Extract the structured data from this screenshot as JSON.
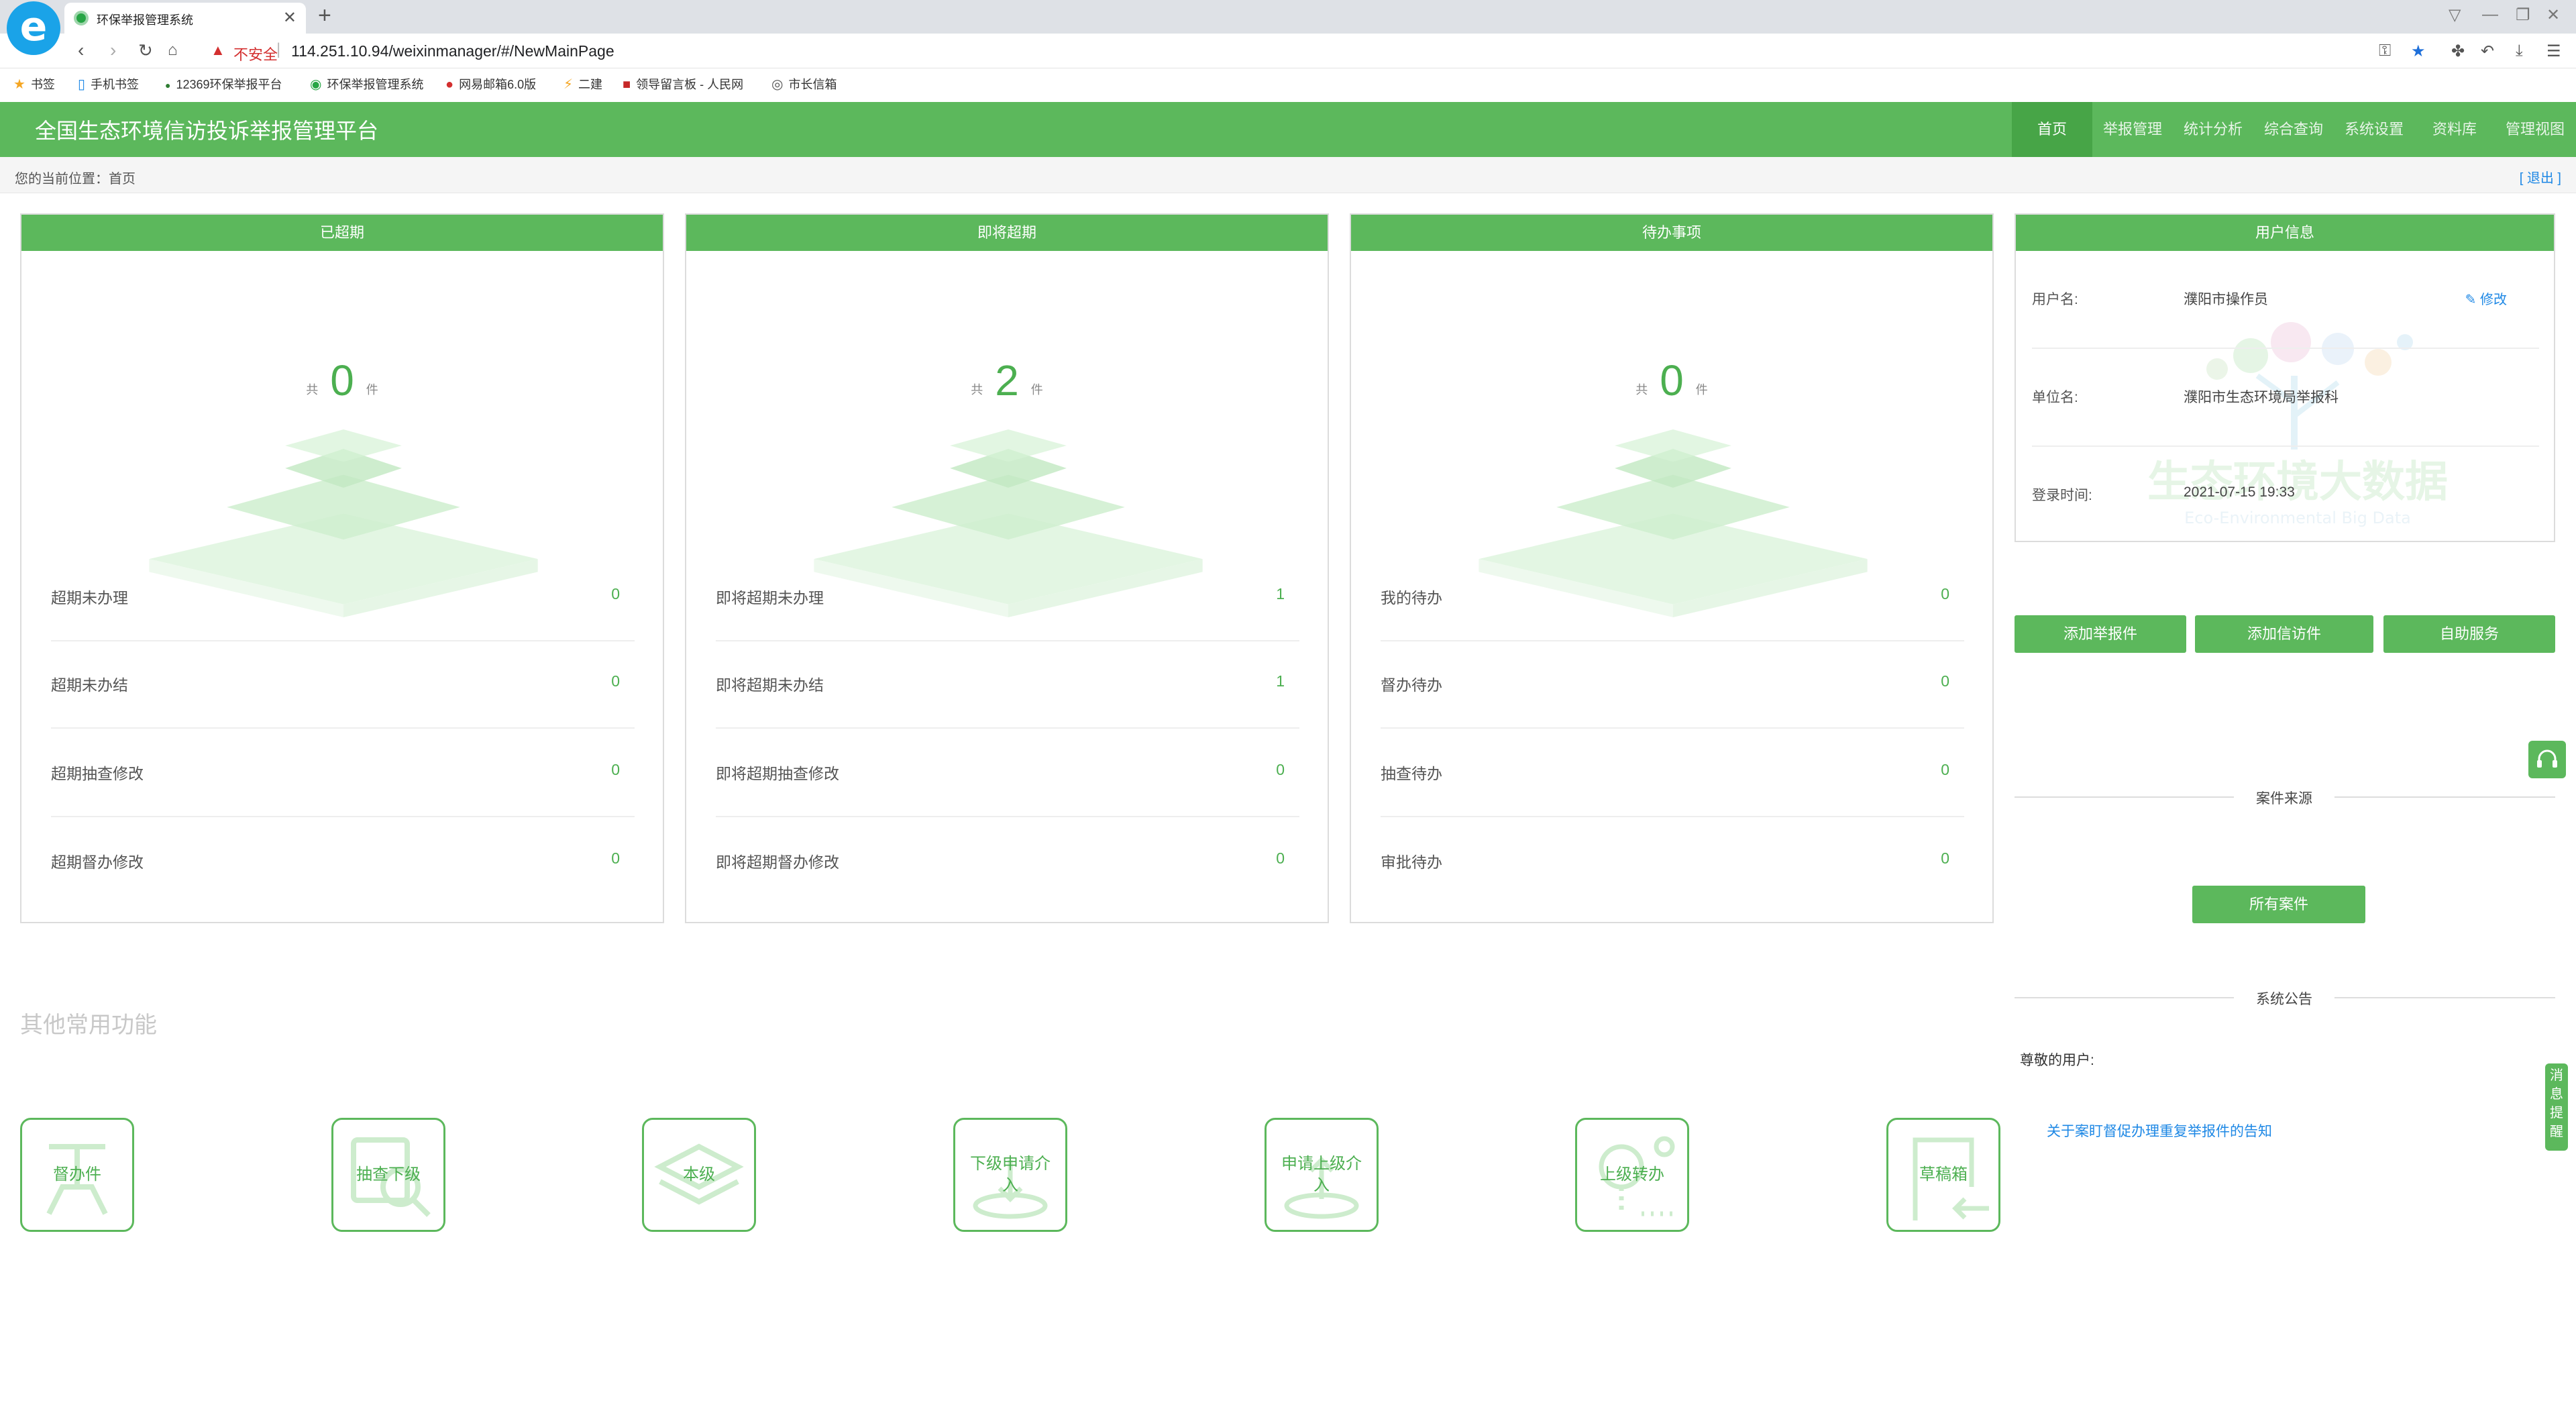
{
  "browser": {
    "tab_title": "环保举报管理系统",
    "tab_close": "✕",
    "new_tab": "+",
    "not_secure": "不安全",
    "url": "114.251.10.94/weixinmanager/#/NewMainPage",
    "bookmarks": [
      {
        "icon": "★",
        "label": "书签"
      },
      {
        "icon": "▯",
        "label": "手机书签"
      },
      {
        "icon": "●",
        "label": "12369环保举报平台"
      },
      {
        "icon": "◉",
        "label": "环保举报管理系统"
      },
      {
        "icon": "●",
        "label": "网易邮箱6.0版"
      },
      {
        "icon": "⚡",
        "label": "二建"
      },
      {
        "icon": "■",
        "label": "领导留言板 - 人民网"
      },
      {
        "icon": "◎",
        "label": "市长信箱"
      }
    ]
  },
  "header": {
    "title": "全国生态环境信访投诉举报管理平台",
    "nav": [
      "首页",
      "举报管理",
      "统计分析",
      "综合查询",
      "系统设置",
      "资料库",
      "管理视图"
    ]
  },
  "breadcrumb": {
    "text": "您的当前位置：首页",
    "logout": "[ 退出 ]"
  },
  "cards": [
    {
      "title": "已超期",
      "total_prefix": "共",
      "total": "0",
      "total_suffix": "件",
      "rows": [
        {
          "label": "超期未办理",
          "value": "0"
        },
        {
          "label": "超期未办结",
          "value": "0"
        },
        {
          "label": "超期抽查修改",
          "value": "0"
        },
        {
          "label": "超期督办修改",
          "value": "0"
        }
      ]
    },
    {
      "title": "即将超期",
      "total_prefix": "共",
      "total": "2",
      "total_suffix": "件",
      "rows": [
        {
          "label": "即将超期未办理",
          "value": "1"
        },
        {
          "label": "即将超期未办结",
          "value": "1"
        },
        {
          "label": "即将超期抽查修改",
          "value": "0"
        },
        {
          "label": "即将超期督办修改",
          "value": "0"
        }
      ]
    },
    {
      "title": "待办事项",
      "total_prefix": "共",
      "total": "0",
      "total_suffix": "件",
      "rows": [
        {
          "label": "我的待办",
          "value": "0"
        },
        {
          "label": "督办待办",
          "value": "0"
        },
        {
          "label": "抽查待办",
          "value": "0"
        },
        {
          "label": "审批待办",
          "value": "0"
        }
      ]
    }
  ],
  "user_info": {
    "title": "用户信息",
    "username_label": "用户名:",
    "username": "濮阳市操作员",
    "edit": "修改",
    "unit_label": "单位名:",
    "unit": "濮阳市生态环境局举报科",
    "login_label": "登录时间:",
    "login_time": "2021-07-15 19:33",
    "watermark_cn": "生态环境大数据",
    "watermark_en": "Eco-Environmental Big Data"
  },
  "actions": [
    "添加举报件",
    "添加信访件",
    "自助服务"
  ],
  "case_source": {
    "title": "案件来源",
    "button": "所有案件"
  },
  "announcement": {
    "title": "系统公告",
    "greeting": "尊敬的用户:",
    "link": "关于案盯督促办理重复举报件的告知"
  },
  "float_msg": "消息提醒",
  "common": {
    "heading": "其他常用功能",
    "items": [
      {
        "label": "督办件",
        "icon": "supervise-icon"
      },
      {
        "label": "抽查下级",
        "icon": "inspect-icon"
      },
      {
        "label": "本级",
        "icon": "layers-icon"
      },
      {
        "label": "下级申请介入",
        "icon": "apply-down-icon"
      },
      {
        "label": "申请上级介入",
        "icon": "apply-up-icon"
      },
      {
        "label": "上级转办",
        "icon": "transfer-icon"
      },
      {
        "label": "草稿箱",
        "icon": "draft-icon"
      }
    ]
  },
  "colors": {
    "primary": "#5cb85c",
    "link": "#1e88e5",
    "danger": "#d32f2f"
  }
}
